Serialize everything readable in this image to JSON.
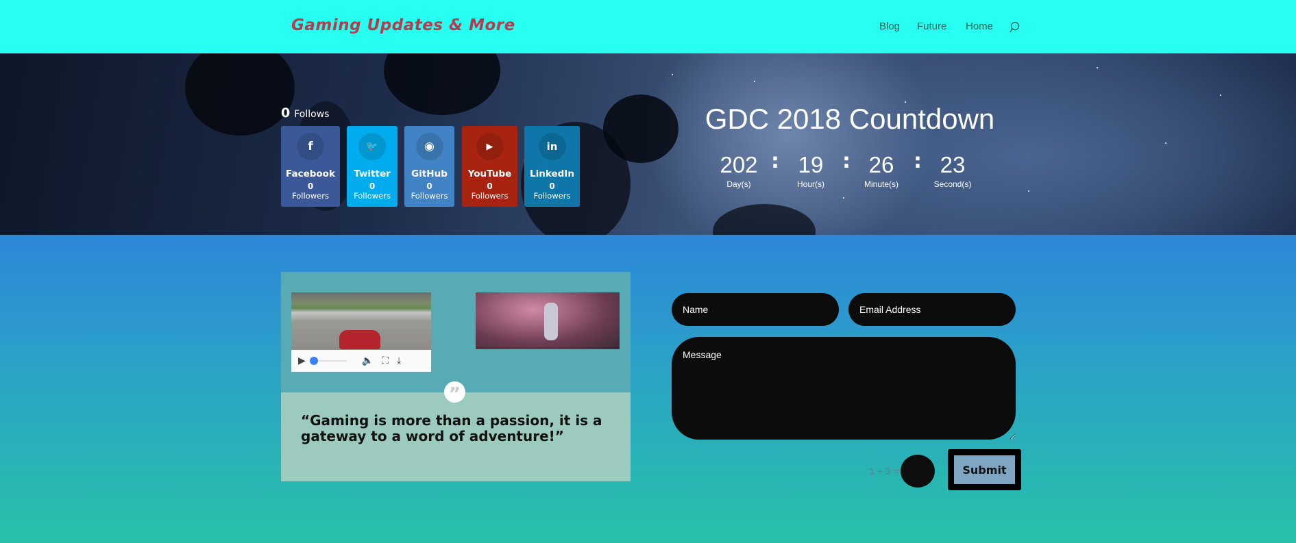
{
  "header": {
    "logo": "Gaming Updates & More",
    "nav": [
      "Blog",
      "Future",
      "Home"
    ],
    "search_icon": "search-icon"
  },
  "social": {
    "total_count": "0",
    "total_label": "Follows",
    "items": [
      {
        "name": "Facebook",
        "icon": "f",
        "count": "0",
        "label": "Followers",
        "color": "#3b5998"
      },
      {
        "name": "Twitter",
        "icon": "🐦",
        "count": "0",
        "label": "Followers",
        "color": "#00aced"
      },
      {
        "name": "GitHub",
        "icon": "◉",
        "count": "0",
        "label": "Followers",
        "color": "#4183c4"
      },
      {
        "name": "YouTube",
        "icon": "▶",
        "count": "0",
        "label": "Followers",
        "color": "#a82400"
      },
      {
        "name": "LinkedIn",
        "icon": "in",
        "count": "0",
        "label": "Followers",
        "color": "#0e76a8"
      }
    ]
  },
  "countdown": {
    "title": "GDC 2018 Countdown",
    "units": [
      {
        "value": "202",
        "label": "Day(s)"
      },
      {
        "value": "19",
        "label": "Hour(s)"
      },
      {
        "value": "26",
        "label": "Minute(s)"
      },
      {
        "value": "23",
        "label": "Second(s)"
      }
    ],
    "separator": ":"
  },
  "media": {
    "quote": "“Gaming is more than a passion, it is a gateway to a word of adventure!”",
    "quote_mark": "”"
  },
  "form": {
    "name_placeholder": "Name",
    "email_placeholder": "Email Address",
    "message_placeholder": "Message",
    "captcha": "1 + 3 =",
    "submit": "Submit"
  }
}
